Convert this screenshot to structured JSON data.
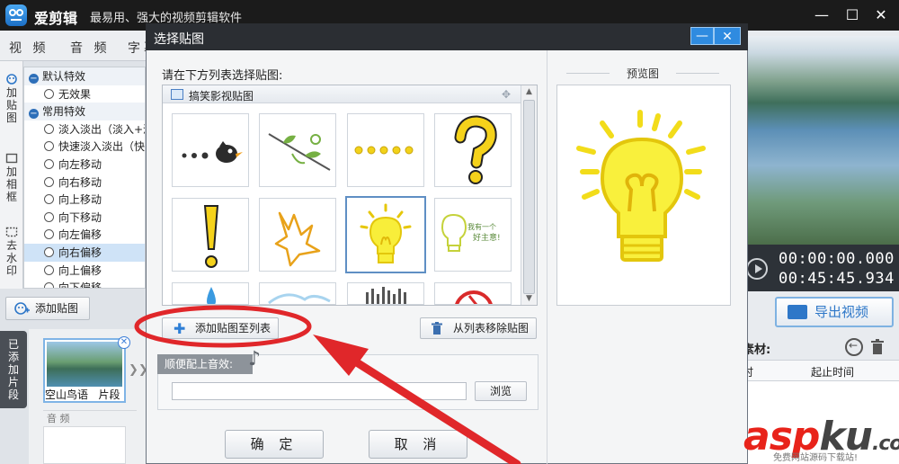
{
  "app": {
    "name": "爱剪辑",
    "slogan": "最易用、强大的视频剪辑软件",
    "window_controls": [
      "minimize-icon",
      "maximize-icon",
      "close-icon"
    ]
  },
  "main_tabs": [
    "视 频",
    "音 频",
    "字幕"
  ],
  "side_tabs": [
    "加贴图",
    "加相框",
    "去水印"
  ],
  "effects": [
    {
      "type": "group",
      "label": "默认特效"
    },
    {
      "type": "item",
      "label": "无效果"
    },
    {
      "type": "group",
      "label": "常用特效"
    },
    {
      "type": "item",
      "label": "淡入淡出（淡入+淡"
    },
    {
      "type": "item",
      "label": "快速淡入淡出（快"
    },
    {
      "type": "item",
      "label": "向左移动"
    },
    {
      "type": "item",
      "label": "向右移动"
    },
    {
      "type": "item",
      "label": "向上移动"
    },
    {
      "type": "item",
      "label": "向下移动"
    },
    {
      "type": "item",
      "label": "向左偏移"
    },
    {
      "type": "item",
      "label": "向右偏移",
      "selected": true
    },
    {
      "type": "item",
      "label": "向上偏移"
    },
    {
      "type": "item",
      "label": "向下偏移"
    }
  ],
  "left_add_button": "添加贴图",
  "clips": {
    "panel_label": "已添加片段",
    "clip_name": "空山鸟语",
    "clip_suffix": "片段",
    "audio_label": "音 频"
  },
  "preview_panel": {
    "time_current": "00:00:00.000",
    "time_total": "00:45:45.934",
    "export_label": "导出视频",
    "material_label": "素材:",
    "col_1": "时",
    "col_2": "起止时间"
  },
  "dialog": {
    "title": "选择贴图",
    "minimize": "—",
    "close": "✕",
    "instruction": "请在下方列表选择贴图:",
    "category": "搞笑影视贴图",
    "stickers": [
      "dots-bird",
      "branch-leaves",
      "yellow-dots",
      "question-mark",
      "exclamation-mark",
      "yellow-burst",
      "lightbulb",
      "lightbulb-sketch",
      "water-drop",
      "blue-splash",
      "dark-smoke",
      "red-circle-sign"
    ],
    "selected_sticker": "lightbulb",
    "sticker_text": "我有一个好主意!",
    "add_to_list": "添加贴图至列表",
    "remove_from_list": "从列表移除贴图",
    "audio_section_label": "顺便配上音效:",
    "audio_path": "",
    "browse": "浏览",
    "ok": "确 定",
    "cancel": "取 消",
    "preview_title": "预览图"
  },
  "watermark": {
    "asp": "asp",
    "ku": "ku",
    "com": ".com",
    "sub": "免费网站源码下载站!"
  },
  "colors": {
    "annotation_red": "#e0272a",
    "accent_blue": "#2f8be0",
    "bulb_yellow": "#f5e21b"
  }
}
